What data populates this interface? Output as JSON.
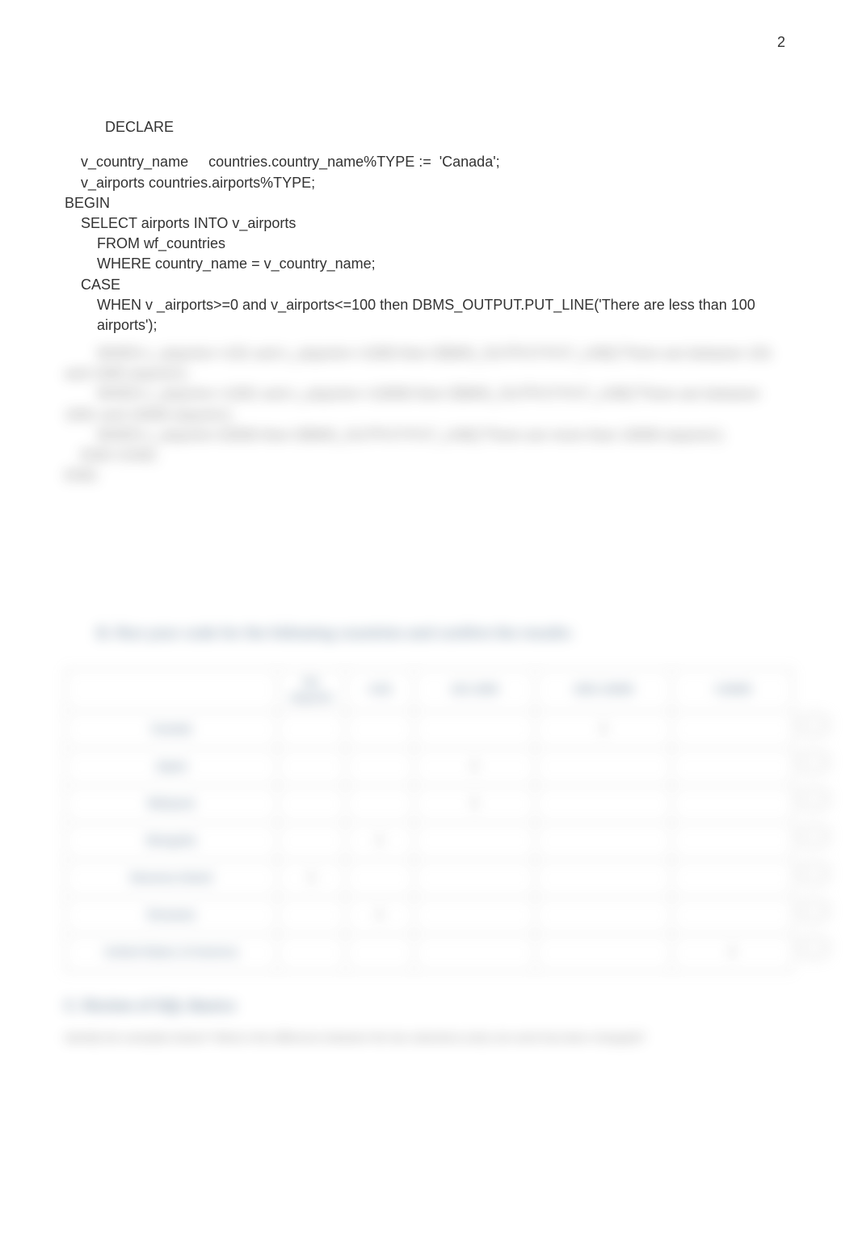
{
  "page_number": "2",
  "declare_label": "DECLARE",
  "code_lines": [
    {
      "indent": 1,
      "text": "v_country_name     countries.country_name%TYPE :=  'Canada';"
    },
    {
      "indent": 1,
      "text": "v_airports countries.airports%TYPE;"
    },
    {
      "indent": 0,
      "text": "BEGIN"
    },
    {
      "indent": 1,
      "text": "SELECT airports INTO v_airports"
    },
    {
      "indent": 2,
      "text": "FROM wf_countries"
    },
    {
      "indent": 2,
      "text": "WHERE country_name = v_country_name;"
    },
    {
      "indent": 1,
      "text": "CASE"
    },
    {
      "indent": 2,
      "text": "WHEN v _airports>=0 and v_airports<=100 then DBMS_OUTPUT.PUT_LINE('There are less than 100 airports');"
    }
  ],
  "blurred_code_lines": [
    "        WHEN v_airports>=101 and v_airports<=1000 then DBMS_OUTPUT.PUT_LINE('There are between 101 and 1000 airports');",
    "        WHEN v_airports>=1001 and v_airports<=10000 then DBMS_OUTPUT.PUT_LINE('There are between 1001 and 10000 airports');",
    "        WHEN v_airports>10000 then DBMS_OUTPUT.PUT_LINE('There are more than 10000 airports');",
    "    END CASE;",
    "END;"
  ],
  "blurred_heading": "B. Run your code for the following countries and confirm the results:",
  "table": {
    "headers": [
      "",
      "No airports",
      "<101",
      "101-1000",
      "1001-10000",
      ">10000"
    ],
    "rows": [
      {
        "label": "Canada",
        "col": 4
      },
      {
        "label": "Japan",
        "col": 3
      },
      {
        "label": "Malaysia",
        "col": 3
      },
      {
        "label": "Mongolia",
        "col": 2
      },
      {
        "label": "Navassa Island",
        "col": 1
      },
      {
        "label": "Romania",
        "col": 2
      },
      {
        "label": "United States of America",
        "col": 5
      }
    ]
  },
  "side_marks": [
    "",
    "",
    "",
    "",
    "",
    "",
    ""
  ],
  "blurred_subheading": "C. Review of SQL Basics",
  "blurred_paragraph": "Identify the examples below? What is the difference between the two selections (only one word has been changed)?"
}
